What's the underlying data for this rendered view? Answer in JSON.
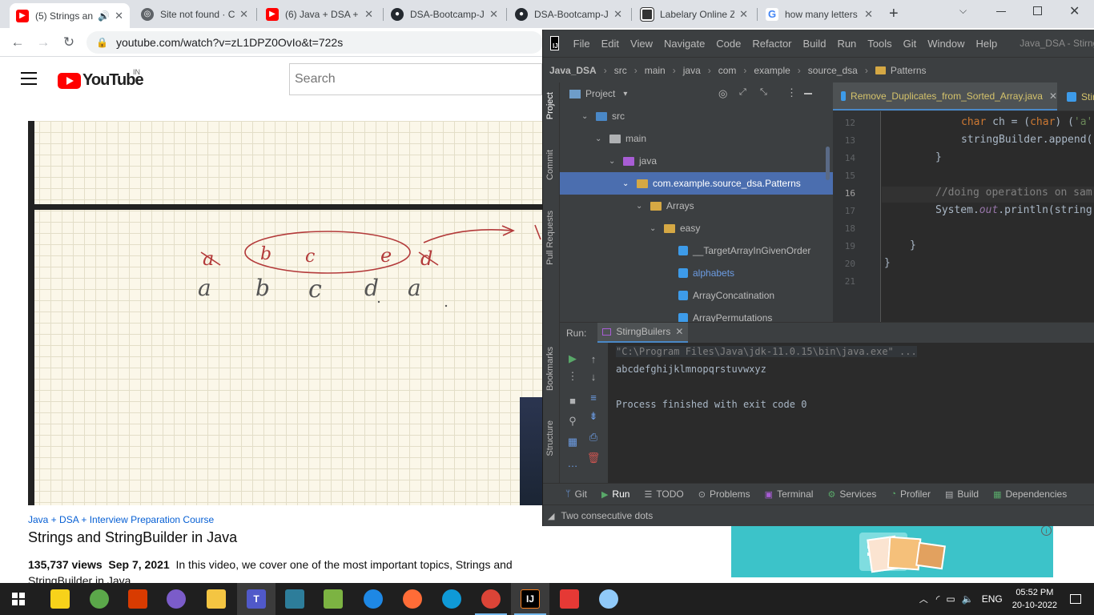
{
  "browser": {
    "tabs": [
      {
        "title": "(5) Strings an",
        "icon": "youtube-icon",
        "color": "#ff0000"
      },
      {
        "title": "Site not found · C",
        "icon": "globe-icon",
        "color": "#5f6368"
      },
      {
        "title": "(6) Java + DSA +",
        "icon": "youtube-icon",
        "color": "#ff0000"
      },
      {
        "title": "DSA-Bootcamp-J",
        "icon": "github-icon",
        "color": "#24292f"
      },
      {
        "title": "DSA-Bootcamp-J",
        "icon": "github-icon",
        "color": "#24292f"
      },
      {
        "title": "Labelary Online Z",
        "icon": "labelary-icon",
        "color": "#333333"
      },
      {
        "title": "how many letters",
        "icon": "google-icon",
        "color": "#4285f4"
      }
    ],
    "new_tab": "+",
    "url": "youtube.com/watch?v=zL1DPZ0OvIo&t=722s"
  },
  "youtube": {
    "logo_text": "YouTube",
    "country": "IN",
    "search_placeholder": "Search",
    "handwriting": {
      "crossed_letters": [
        "a",
        "b",
        "c",
        "e",
        "d"
      ],
      "letters": [
        "a",
        "b",
        "c",
        "d",
        "a"
      ]
    },
    "course_link": "Java + DSA + Interview Preparation Course",
    "video_title": "Strings and StringBuilder in Java",
    "views": "135,737 views",
    "date": "Sep 7, 2021",
    "description": "In this video, we cover one of the most important topics, Strings and StringBuilder in Java.",
    "ad_info": "i"
  },
  "ide": {
    "menu": [
      "File",
      "Edit",
      "View",
      "Navigate",
      "Code",
      "Refactor",
      "Build",
      "Run",
      "Tools",
      "Git",
      "Window",
      "Help"
    ],
    "window_title": "Java_DSA - Stirng",
    "breadcrumb": [
      "Java_DSA",
      "src",
      "main",
      "java",
      "com",
      "example",
      "source_dsa",
      "Patterns"
    ],
    "left_strip": [
      "Project",
      "Commit",
      "Pull Requests",
      "Bookmarks",
      "Structure"
    ],
    "project_header": "Project",
    "tree": [
      {
        "label": "src",
        "level": 1,
        "icon": "src"
      },
      {
        "label": "main",
        "level": 2,
        "icon": "plain"
      },
      {
        "label": "java",
        "level": 3,
        "icon": "java"
      },
      {
        "label": "com.example.source_dsa.Patterns",
        "level": 4,
        "icon": "folder",
        "selected": true
      },
      {
        "label": "Arrays",
        "level": 5,
        "icon": "folder"
      },
      {
        "label": "easy",
        "level": 6,
        "icon": "folder"
      },
      {
        "label": "__TargetArrayInGivenOrder",
        "level": 7,
        "icon": "class"
      },
      {
        "label": "alphabets",
        "level": 7,
        "icon": "class",
        "blue": true
      },
      {
        "label": "ArrayConcatination",
        "level": 7,
        "icon": "class"
      },
      {
        "label": "ArrayPermutations",
        "level": 7,
        "icon": "class"
      }
    ],
    "editor_tabs": [
      "Remove_Duplicates_from_Sorted_Array.java",
      "Stir"
    ],
    "line_numbers": [
      "12",
      "13",
      "14",
      "15",
      "16",
      "17",
      "18",
      "19",
      "20",
      "21"
    ],
    "run_label": "Run:",
    "run_tab": "StirngBuilers",
    "console": [
      "\"C:\\Program Files\\Java\\jdk-11.0.15\\bin\\java.exe\" ...",
      "abcdefghijklmnopqrstuvwxyz",
      "",
      "Process finished with exit code 0"
    ],
    "bottom_tools": [
      "Git",
      "Run",
      "TODO",
      "Problems",
      "Terminal",
      "Services",
      "Profiler",
      "Build",
      "Dependencies"
    ],
    "status": "Two consecutive dots"
  },
  "taskbar": {
    "apps": [
      "start",
      "sticky-notes",
      "green-app",
      "office",
      "github-desktop",
      "file-explorer",
      "teams",
      "snipping",
      "notepad",
      "feedback",
      "postman",
      "edge",
      "chrome",
      "intellij",
      "dots-app",
      "paint"
    ],
    "lang": "ENG",
    "time": "05:52 PM",
    "date": "20-10-2022"
  }
}
